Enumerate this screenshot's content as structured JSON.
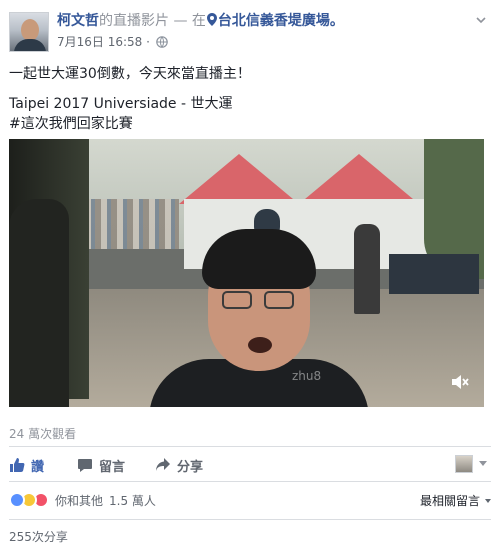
{
  "post": {
    "author": "柯文哲",
    "verb": "的直播影片",
    "separator": " — 在",
    "place": "台北信義香堤廣場。",
    "date": "7月16日",
    "time": "16:58",
    "dot": "·",
    "line1": "一起世大運30倒數，今天來當直播主！",
    "line2": "Taipei 2017 Universiade - 世大運",
    "line3": "#這次我們回家比賽"
  },
  "video": {
    "watermark": "zhu8"
  },
  "stats": {
    "views": "24 萬次觀看",
    "reactions_text": "你和其他",
    "reactions_count": "1.5 萬人",
    "sort_label": "最相關留言",
    "shares": "255次分享"
  },
  "actions": {
    "like": "讚",
    "comment": "留言",
    "share": "分享"
  },
  "colors": {
    "link": "#365899",
    "like_active": "#4267b2",
    "muted": "#90949c"
  }
}
